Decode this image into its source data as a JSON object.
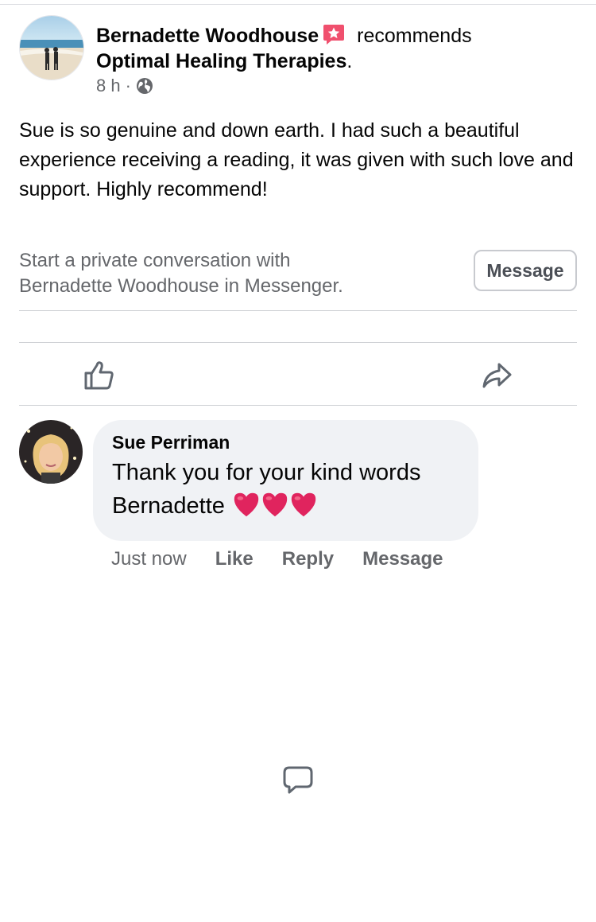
{
  "post": {
    "author": "Bernadette Woodhouse",
    "verb": "recommends",
    "page": "Optimal Healing Therapies",
    "page_suffix": ".",
    "time": "8 h",
    "separator": "·",
    "audience_icon": "globe-icon",
    "body": "Sue is so genuine and down earth. I had such a beautiful experience receiving a reading, it was given with such love and support. Highly recommend!"
  },
  "messenger_prompt": {
    "line1": "Start a private conversation with",
    "line2": "Bernadette Woodhouse in Messenger.",
    "button_label": "Message"
  },
  "actions": {
    "like_icon": "thumbs-up-icon",
    "comment_icon": "speech-bubble-icon",
    "share_icon": "share-arrow-icon"
  },
  "comment": {
    "author": "Sue Perriman",
    "line1": "Thank you for your kind words",
    "line2": "Bernadette",
    "emoji": "heart-icon ×3",
    "time": "Just now",
    "like_label": "Like",
    "reply_label": "Reply",
    "message_label": "Message"
  },
  "colors": {
    "badge": "#f0506e",
    "secondary_text": "#65676b",
    "bubble": "#f0f2f5",
    "heart": "#e0245e"
  }
}
